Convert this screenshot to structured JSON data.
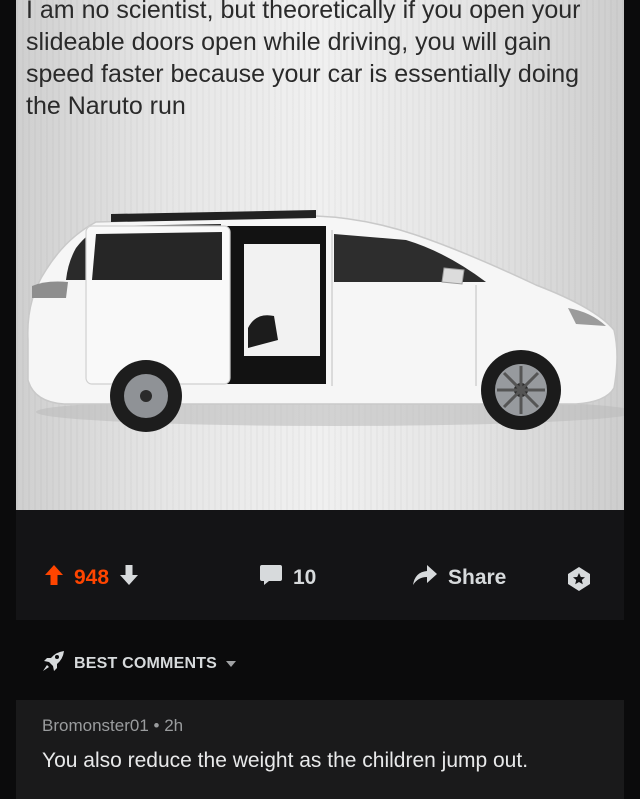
{
  "post": {
    "meme_text": "I am no scientist, but theoretically if you open your slideable doors open while driving, you will gain speed faster because your car is essentially doing the Naruto run",
    "image_subject": "white-minivan-with-open-sliding-door"
  },
  "actions": {
    "score": "948",
    "comments_count": "10",
    "share_label": "Share"
  },
  "comments_section": {
    "sort_label": "BEST COMMENTS"
  },
  "comment": {
    "author": "Bromonster01",
    "separator": "•",
    "age": "2h",
    "body": "You also reduce the weight as the children jump out."
  },
  "colors": {
    "upvote": "#ff4500",
    "text": "#d7dadc",
    "background": "#0b0b0c",
    "panel": "#1a1a1b"
  },
  "icons": [
    "upvote-arrow-icon",
    "downvote-arrow-icon",
    "comment-bubble-icon",
    "share-arrow-icon",
    "award-icon",
    "rocket-icon",
    "chevron-down-icon"
  ]
}
